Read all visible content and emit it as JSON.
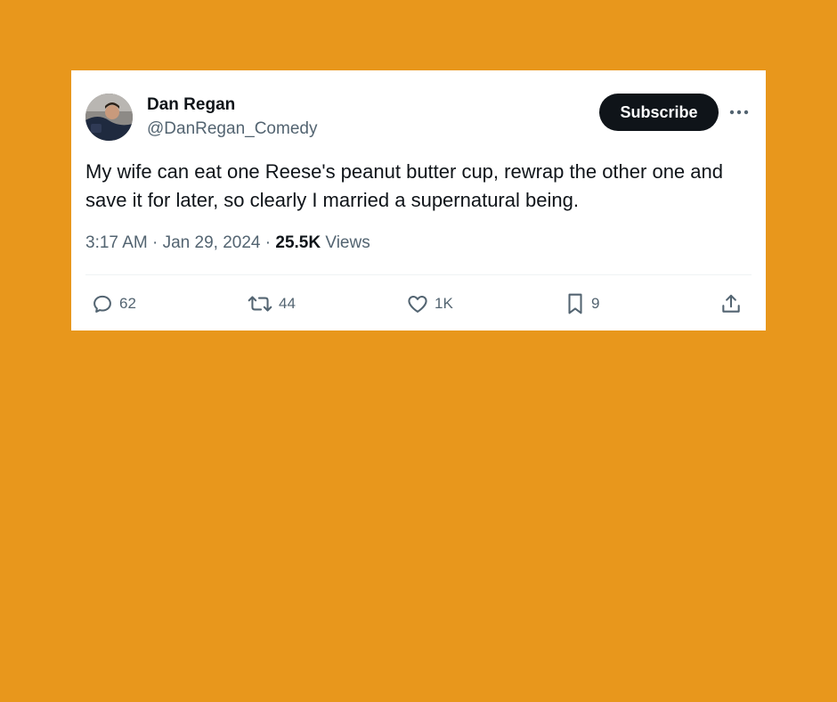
{
  "theme": {
    "background": "#E8971C",
    "card": "#FFFFFF",
    "text_primary": "#0F1419",
    "text_secondary": "#536471",
    "button_bg": "#0F1419"
  },
  "author": {
    "name": "Dan Regan",
    "handle": "@DanRegan_Comedy",
    "avatar_icon": "profile-photo"
  },
  "header": {
    "subscribe_label": "Subscribe",
    "more_icon": "more-horizontal-icon"
  },
  "tweet": {
    "text": "My wife can eat one Reese's peanut butter cup, rewrap the other one and save it for later, so clearly I married a supernatural being.",
    "time": "3:17 AM",
    "separator": "·",
    "date": "Jan 29, 2024",
    "views_count": "25.5K",
    "views_label": "Views"
  },
  "actions": {
    "reply": {
      "icon": "reply-icon",
      "count": "62"
    },
    "retweet": {
      "icon": "retweet-icon",
      "count": "44"
    },
    "like": {
      "icon": "heart-icon",
      "count": "1K"
    },
    "bookmark": {
      "icon": "bookmark-icon",
      "count": "9"
    },
    "share": {
      "icon": "share-icon"
    }
  }
}
